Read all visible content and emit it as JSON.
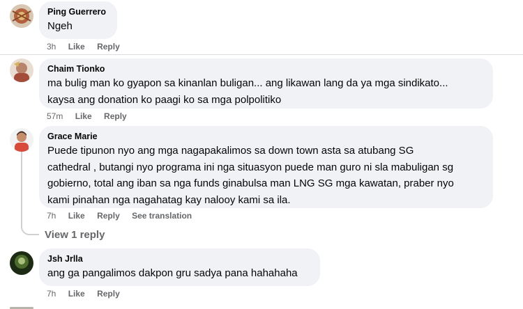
{
  "comments": [
    {
      "author": "Ping Guerrero",
      "lines": [
        "Ngeh"
      ],
      "time": "3h",
      "like": "Like",
      "reply": "Reply"
    },
    {
      "author": "Chaim Tionko",
      "lines": [
        "ma bulig man ko gyapon sa kinanlan buligan... ang likawan lang da ya mga sindikato...",
        "kaysa ang donation ko paagi ko sa mga polpolitiko"
      ],
      "time": "57m",
      "like": "Like",
      "reply": "Reply"
    },
    {
      "author": "Grace Marie",
      "lines": [
        "Puede tipunon nyo ang mga nagapakalimos sa down town asta sa atubang SG",
        "cathedral , butangi nyo programa ini nga situasyon puede man guro ni sla mabuligan sg",
        "gobierno, total ang iban sa nga funds ginabulsa man LNG SG mga kawatan, praber nyo",
        "kami pinahan nga nagahatag kay nalooy kami sa ila."
      ],
      "time": "7h",
      "like": "Like",
      "reply": "Reply",
      "translate": "See translation",
      "view_replies": "View 1 reply"
    },
    {
      "author": "Jsh Jrlla",
      "lines": [
        "ang ga pangalimos dakpon gru sadya pana hahahaha"
      ],
      "time": "7h",
      "like": "Like",
      "reply": "Reply"
    }
  ],
  "colors": {
    "bubble": "#f0f2f5",
    "secondary_text": "#65676b",
    "primary_text": "#050505"
  }
}
